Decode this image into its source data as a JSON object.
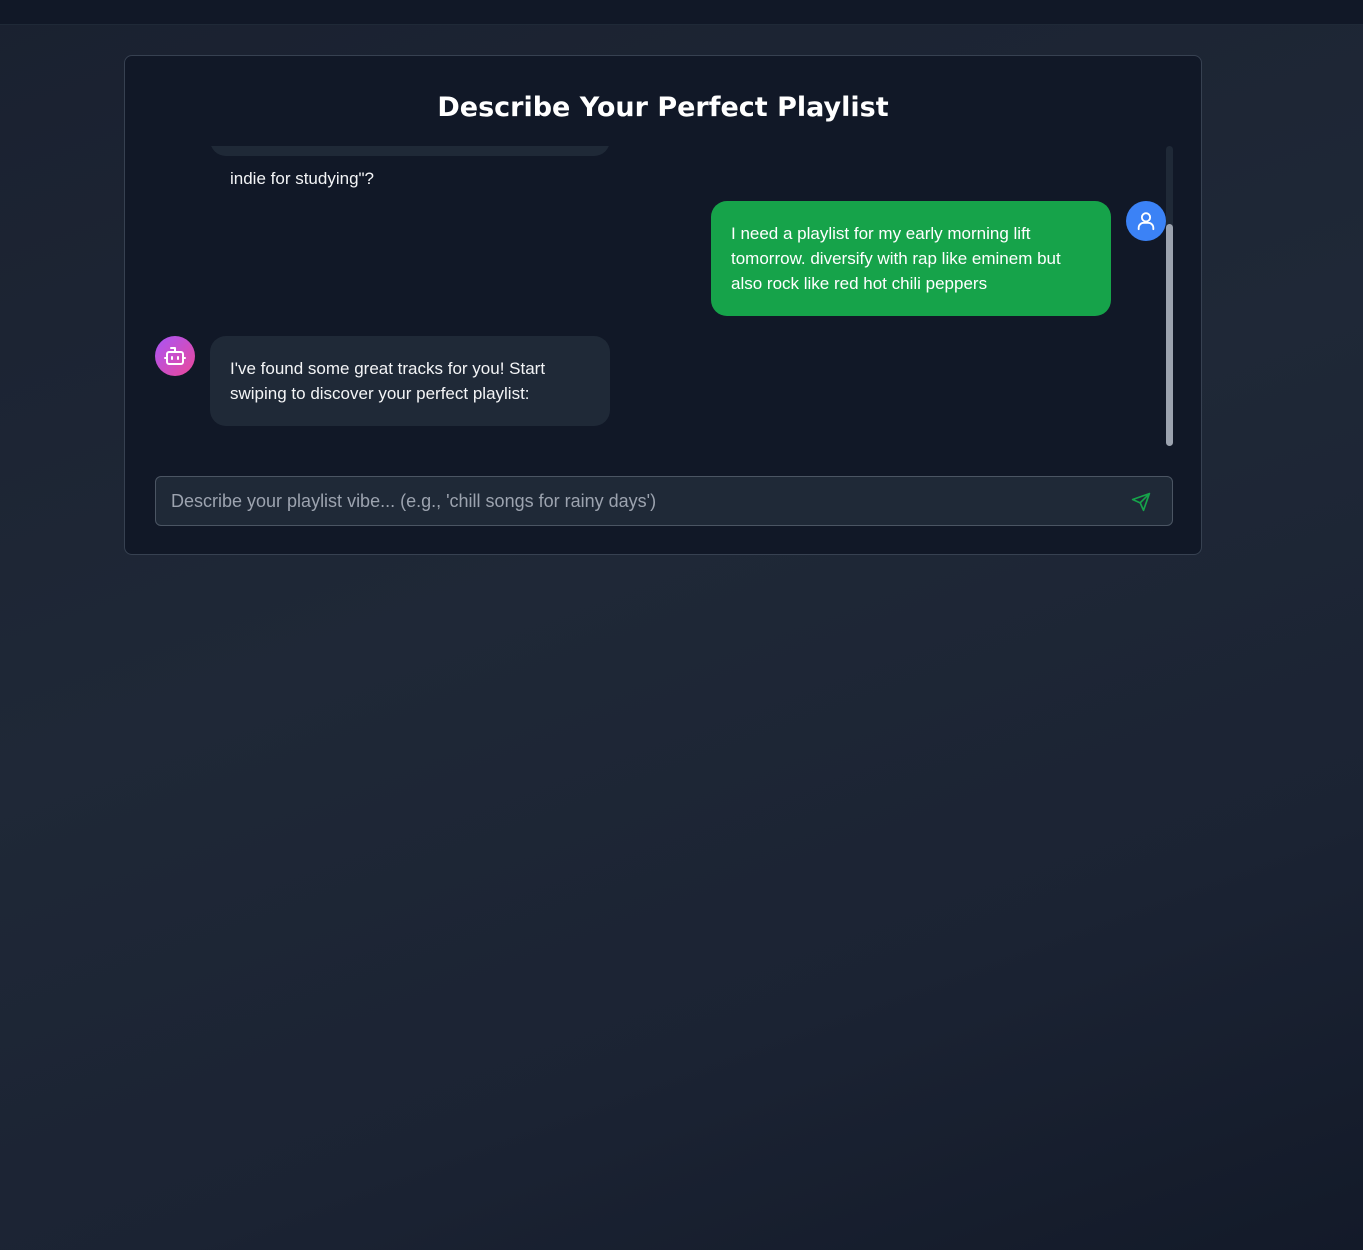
{
  "header": {
    "title": "Describe Your Perfect Playlist"
  },
  "messages": [
    {
      "sender": "bot",
      "text": "Want to describe your vibe? Try something like \"upbeat indie for studying\"?",
      "visible_text": "indie for studying\"?"
    },
    {
      "sender": "user",
      "text": "I need a playlist for my early morning lift tomorrow. diversify with rap like eminem but also rock like red hot chili peppers"
    },
    {
      "sender": "bot",
      "text": "I've found some great tracks for you! Start swiping to discover your perfect playlist:"
    }
  ],
  "input": {
    "placeholder": "Describe your playlist vibe... (e.g., 'chill songs for rainy days')",
    "value": ""
  },
  "icons": {
    "user_avatar": "user-icon",
    "bot_avatar": "bot-icon",
    "send": "send-icon"
  },
  "colors": {
    "page_bg": "#1f2937",
    "card_bg": "#111827",
    "bot_bubble": "#1f2937",
    "user_bubble": "#16a34a",
    "user_avatar": "#3b82f6",
    "bot_avatar_from": "#a855f7",
    "bot_avatar_to": "#ec4899",
    "send_icon": "#16a34a"
  }
}
